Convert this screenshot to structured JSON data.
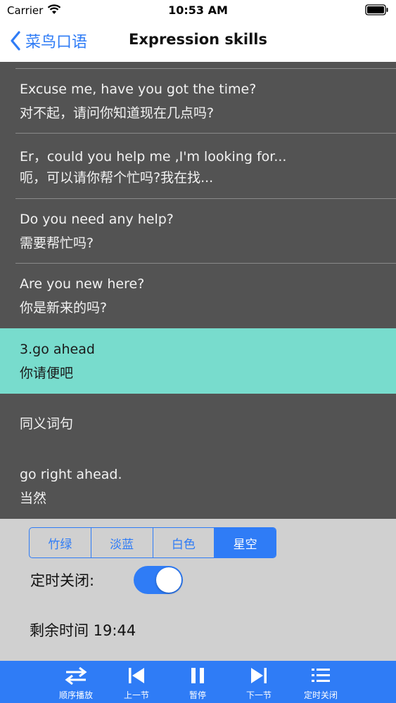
{
  "status_bar": {
    "carrier": "Carrier",
    "time": "10:53 AM"
  },
  "nav": {
    "back_label": "菜鸟口语",
    "title": "Expression skills"
  },
  "list": {
    "rows": [
      {
        "en": "Excuse me, have you got the time?",
        "zh": "对不起，请问你知道现在几点吗?"
      },
      {
        "en": "Er，could you help me ,I'm looking for...",
        "zh": "呃，可以请你帮个忙吗?我在找..."
      },
      {
        "en": "Do you need any help?",
        "zh": "需要帮忙吗?"
      },
      {
        "en": "Are you new here?",
        "zh": "你是新来的吗?"
      },
      {
        "en": "3.go ahead",
        "zh": "你请便吧"
      },
      {
        "en": "同义词句",
        "zh": ""
      },
      {
        "en": "go right ahead.",
        "zh": "当然"
      }
    ]
  },
  "theme_options": [
    "竹绿",
    "淡蓝",
    "白色",
    "星空"
  ],
  "selected_theme": "星空",
  "timer": {
    "label": "定时关闭:",
    "enabled": true,
    "remaining": "剩余时间 19:44"
  },
  "toolbar": {
    "order_play": "顺序播放",
    "previous": "上一节",
    "pause": "暂停",
    "next": "下一节",
    "timer_off": "定时关闭"
  },
  "colors": {
    "accent": "#2f7cf6",
    "highlight_row": "#78dccd",
    "list_background": "#535353",
    "panel_background": "#d0d0d0"
  }
}
